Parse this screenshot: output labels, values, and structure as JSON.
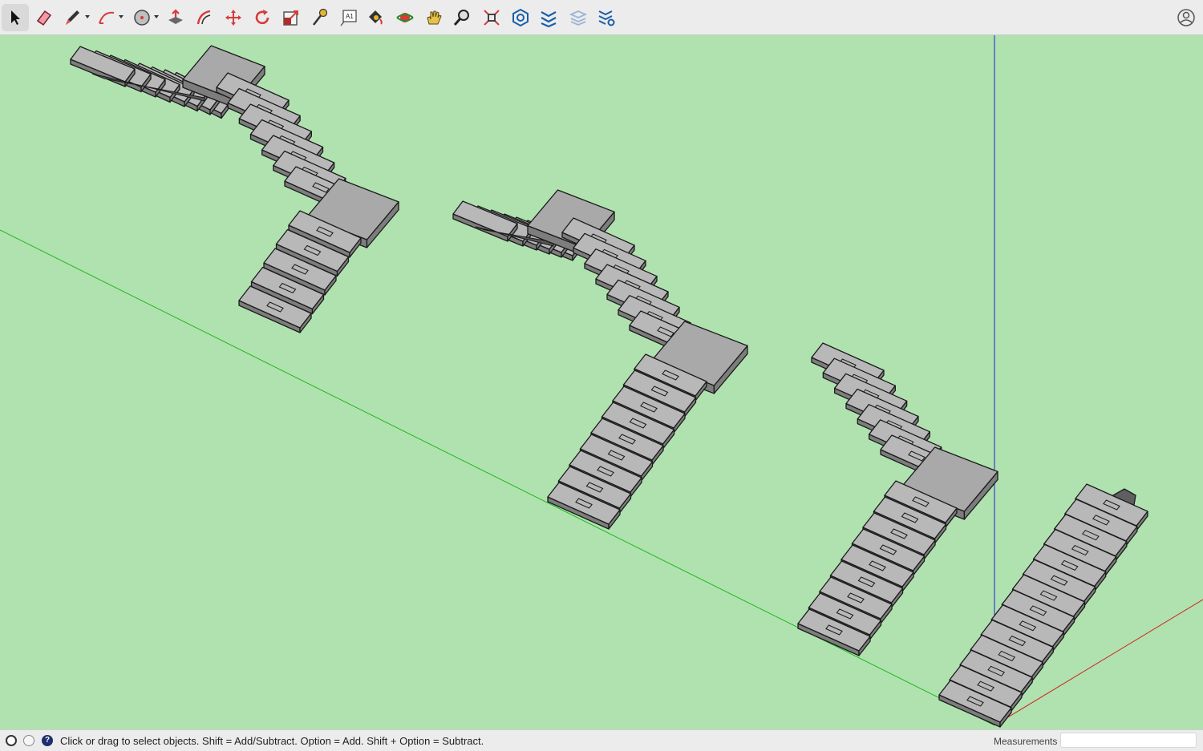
{
  "toolbar": {
    "tools": [
      {
        "name": "select-tool",
        "icon": "arrow-cursor-icon",
        "active": true
      },
      {
        "name": "eraser-tool",
        "icon": "eraser-icon"
      },
      {
        "name": "line-tool",
        "icon": "pencil-icon",
        "dropdown": true
      },
      {
        "name": "arc-tool",
        "icon": "arc-icon",
        "dropdown": true
      },
      {
        "name": "shape-tool",
        "icon": "circle-icon",
        "dropdown": true
      },
      {
        "name": "push-pull-tool",
        "icon": "push-pull-icon"
      },
      {
        "name": "offset-tool",
        "icon": "offset-icon"
      },
      {
        "name": "move-tool",
        "icon": "move-arrows-icon"
      },
      {
        "name": "rotate-tool",
        "icon": "rotate-icon"
      },
      {
        "name": "scale-tool",
        "icon": "scale-icon"
      },
      {
        "name": "tape-measure-tool",
        "icon": "tape-measure-icon"
      },
      {
        "name": "text-tool",
        "icon": "text-icon"
      },
      {
        "name": "paint-bucket-tool",
        "icon": "paint-bucket-icon"
      },
      {
        "name": "orbit-tool",
        "icon": "orbit-icon"
      },
      {
        "name": "pan-tool",
        "icon": "hand-icon"
      },
      {
        "name": "zoom-tool",
        "icon": "magnifier-icon"
      },
      {
        "name": "zoom-extents-tool",
        "icon": "zoom-extents-icon"
      },
      {
        "name": "3d-warehouse-tool",
        "icon": "warehouse-icon"
      },
      {
        "name": "extension-warehouse-tool",
        "icon": "extension-warehouse-icon"
      },
      {
        "name": "layout-tool",
        "icon": "layers-icon",
        "disabled": true
      },
      {
        "name": "extension-manager-tool",
        "icon": "extension-manager-icon"
      }
    ],
    "account_icon": "account-icon"
  },
  "status": {
    "icons": [
      "geo-location-icon",
      "credits-icon",
      "help-icon"
    ],
    "message": "Click or drag to select objects. Shift = Add/Subtract. Option = Add. Shift + Option = Subtract.",
    "measurements_label": "Measurements",
    "measurements_value": ""
  },
  "colors": {
    "background": "#b0e2b0",
    "green_axis": "#1fb81f",
    "blue_axis": "#2020d0",
    "red_axis": "#d42020",
    "tread_top": "#b8b8b8",
    "tread_side": "#7d7d7d",
    "landing_top": "#a9a9a9",
    "edge": "#1a1a1a"
  }
}
